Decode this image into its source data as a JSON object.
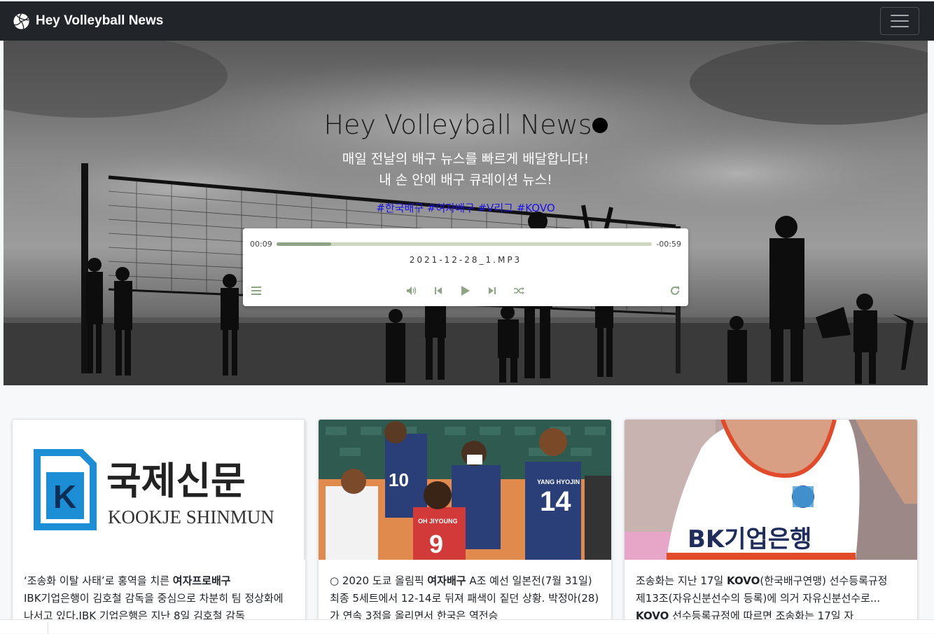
{
  "navbar": {
    "brand": "Hey Volleyball News",
    "brand_icon": "volleyball-icon",
    "toggler_icon": "hamburger-menu-icon"
  },
  "hero": {
    "title": "Hey Volleyball News",
    "subtitle_line1": "매일 전날의 배구 뉴스를 빠르게 배달합니다!",
    "subtitle_line2": "내 손 안에 배구 큐레이션 뉴스!",
    "tags": [
      "#한국배구",
      "#여자배구",
      "#V리그",
      "#KOVO"
    ]
  },
  "player": {
    "elapsed": "00:09",
    "remaining": "-00:59",
    "progress_fraction": 0.145,
    "track": "2021-12-28_1.MP3",
    "accent_color": "#8da584",
    "controls": [
      "playlist-icon",
      "volume-icon",
      "previous-icon",
      "play-icon",
      "next-icon",
      "shuffle-icon",
      "repeat-icon"
    ]
  },
  "cards": [
    {
      "image_label": "KOOKJE SHINMUN",
      "image_label_ko": "국제신문",
      "text_parts": [
        {
          "t": "‘조송화 이탈 사태’로 홍역을 치른 ",
          "b": false
        },
        {
          "t": "여자프로배구",
          "b": true
        },
        {
          "t": " IBK기업은행이 김호철 감독을 중심으로 차분히 팀 정상화에 나서고 있다.IBK 기업은행은 지난 8일 김호철 감독",
          "b": false
        }
      ]
    },
    {
      "image_label": "",
      "jersey_numbers": [
        "10",
        "14",
        "9"
      ],
      "jersey_names": [
        "YANG HYOJIN",
        "OH JIYOUNG"
      ],
      "text_parts": [
        {
          "t": "○ 2020 도쿄 올림픽 ",
          "b": false
        },
        {
          "t": "여자배구",
          "b": true
        },
        {
          "t": " A조 예선 일본전(7월 31일) 최종 5세트에서 12-14로 뒤져 패색이 짙던 상황. 박정아(28)가 연속 3점을 올리면서 한국은 역전승",
          "b": false
        }
      ]
    },
    {
      "image_label": "BK기업은행",
      "text_parts": [
        {
          "t": "조송화는 지난 17일 ",
          "b": false
        },
        {
          "t": "KOVO",
          "b": true
        },
        {
          "t": "(한국배구연맹) 선수등록규정 제13조(자유신분선수의 등록)에 의거 자유신분선수로... ",
          "b": false
        },
        {
          "t": "KOVO",
          "b": true
        },
        {
          "t": " 선수등록규정에 따르면 조송화는 17일 자",
          "b": false
        }
      ]
    }
  ]
}
